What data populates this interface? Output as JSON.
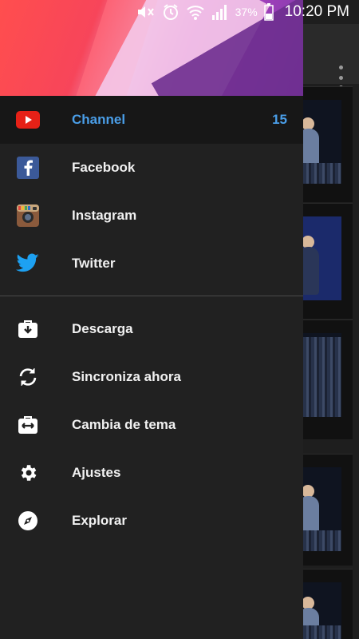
{
  "status_bar": {
    "battery_percent": "37%",
    "time": "10:20 PM",
    "icons": [
      "mute-icon",
      "alarm-icon",
      "wifi-icon",
      "signal-icon",
      "battery-icon"
    ]
  },
  "drawer": {
    "primary_items": [
      {
        "label": "Channel",
        "icon": "youtube-icon",
        "count": "15",
        "active": true
      },
      {
        "label": "Facebook",
        "icon": "facebook-icon"
      },
      {
        "label": "Instagram",
        "icon": "instagram-icon"
      },
      {
        "label": "Twitter",
        "icon": "twitter-icon"
      }
    ],
    "secondary_items": [
      {
        "label": "Descarga",
        "icon": "download-icon"
      },
      {
        "label": "Sincroniza ahora",
        "icon": "sync-icon"
      },
      {
        "label": "Cambia de tema",
        "icon": "theme-icon"
      },
      {
        "label": "Ajustes",
        "icon": "gear-icon"
      },
      {
        "label": "Explorar",
        "icon": "compass-icon"
      }
    ]
  },
  "colors": {
    "accent": "#4a9ee8",
    "drawer_bg": "#212121",
    "youtube_red": "#e62117",
    "facebook_blue": "#3b5998",
    "twitter_blue": "#1da1f2"
  }
}
